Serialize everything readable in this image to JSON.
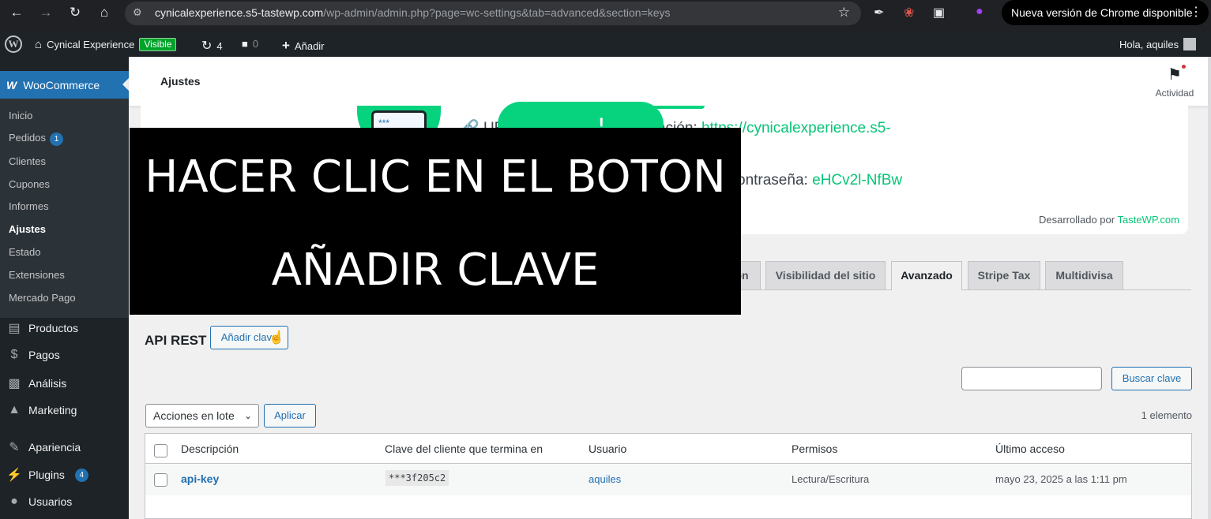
{
  "browser": {
    "url_host": "cynicalexperience.s5-tastewp.com",
    "url_path": "/wp-admin/admin.php?page=wc-settings&tab=advanced&section=keys",
    "update_notice": "Nueva versión de Chrome disponible"
  },
  "adminbar": {
    "site_name": "Cynical Experience",
    "visibility_badge": "Visible",
    "updates_count": "4",
    "comments_count": "0",
    "add_new": "Añadir",
    "greeting": "Hola, aquiles"
  },
  "sidebar": {
    "woo_label": "WooCommerce",
    "woo_submenu": [
      {
        "label": "Inicio"
      },
      {
        "label": "Pedidos",
        "badge": "1"
      },
      {
        "label": "Clientes"
      },
      {
        "label": "Cupones"
      },
      {
        "label": "Informes"
      },
      {
        "label": "Ajustes"
      },
      {
        "label": "Estado"
      },
      {
        "label": "Extensiones"
      },
      {
        "label": "Mercado Pago"
      }
    ],
    "main_items": [
      {
        "label": "Productos",
        "icon": "box-icon"
      },
      {
        "label": "Pagos",
        "icon": "dollar-icon"
      },
      {
        "label": "Análisis",
        "icon": "bar-chart-icon"
      },
      {
        "label": "Marketing",
        "icon": "megaphone-icon"
      },
      {
        "label": "Apariencia",
        "icon": "paintbrush-icon"
      },
      {
        "label": "Plugins",
        "icon": "plug-icon",
        "badge": "4"
      },
      {
        "label": "Usuarios",
        "icon": "user-icon"
      }
    ]
  },
  "header": {
    "title": "Ajustes",
    "activity_label": "Actividad"
  },
  "tastewp": {
    "admin_url_label": "URL del área de administración:",
    "admin_url_value": "https://cynicalexperience.s5-",
    "password_label": "ontraseña:",
    "password_value": "eHCv2l-NfBw",
    "button_fragment": "!",
    "credit_prefix": "Desarrollado por",
    "credit_link": "TasteWP.com"
  },
  "tabs": [
    {
      "label": "ón",
      "active": false
    },
    {
      "label": "Visibilidad del sitio",
      "active": false
    },
    {
      "label": "Avanzado",
      "active": true
    },
    {
      "label": "Stripe Tax",
      "active": false
    },
    {
      "label": "Multidivisa",
      "active": false
    }
  ],
  "overlay": {
    "line1": "HACER CLIC EN EL BOTON",
    "line2": "AÑADIR CLAVE"
  },
  "api": {
    "title": "API REST",
    "add_key_button": "Añadir clave",
    "search_button": "Buscar clave",
    "search_value": "",
    "bulk_actions": "Acciones en lote",
    "apply_button": "Aplicar",
    "item_count": "1 elemento"
  },
  "table": {
    "headers": [
      "Descripción",
      "Clave del cliente que termina en",
      "Usuario",
      "Permisos",
      "Último acceso"
    ],
    "rows": [
      {
        "description": "api-key",
        "key_end": "***3f205c2",
        "user": "aquiles",
        "permissions": "Lectura/Escritura",
        "last_access": "mayo 23, 2025 a las 1:11 pm"
      }
    ]
  },
  "colors": {
    "wp_blue": "#2271b1",
    "tastewp_green": "#07d37f",
    "admin_dark": "#1d2327"
  }
}
